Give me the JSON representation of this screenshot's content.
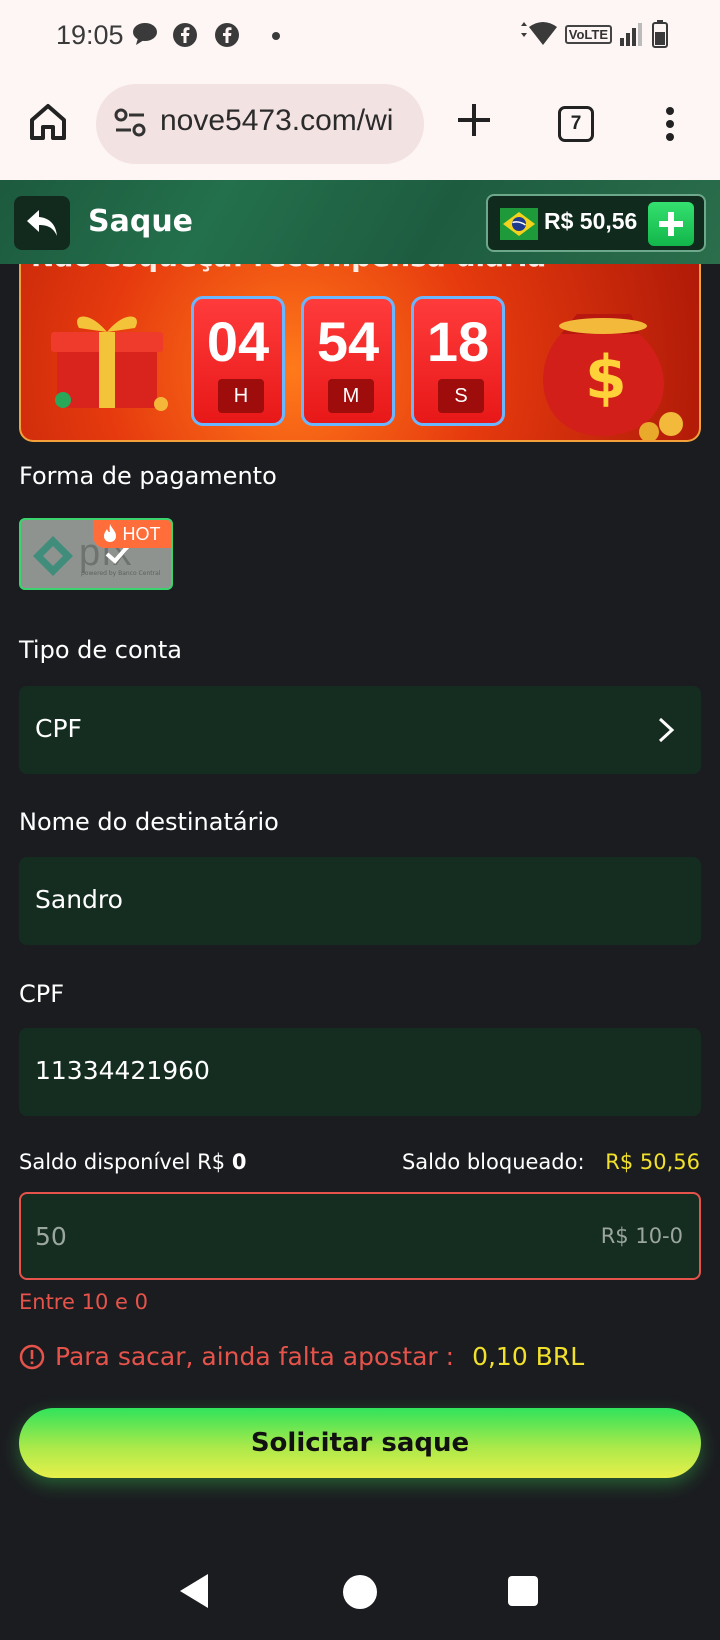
{
  "status_bar": {
    "time": "19:05",
    "volte": "VoLTE"
  },
  "browser": {
    "url": "nove5473.com/wi",
    "tab_count": "7"
  },
  "header": {
    "title": "Saque",
    "balance": "R$ 50,56"
  },
  "promo": {
    "text": "Não esqueça: recompensa diária",
    "timer": [
      {
        "value": "04",
        "unit": "H"
      },
      {
        "value": "54",
        "unit": "M"
      },
      {
        "value": "18",
        "unit": "S"
      }
    ]
  },
  "form": {
    "payment_label": "Forma de pagamento",
    "payment_method": {
      "name": "pix",
      "sub": "powered by Banco Central",
      "badge": "HOT"
    },
    "account_type_label": "Tipo de conta",
    "account_type_value": "CPF",
    "recipient_label": "Nome do destinatário",
    "recipient_value": "Sandro",
    "cpf_label": "CPF",
    "cpf_value": "11334421960",
    "saldo_disponivel_label": "Saldo disponível R$",
    "saldo_disponivel_value": "0",
    "saldo_bloqueado_label": "Saldo bloqueado:",
    "saldo_bloqueado_value": "R$ 50,56",
    "amount_placeholder": "50",
    "amount_range": "R$ 10-0",
    "error_text": "Entre 10 e 0",
    "warning_text": "Para sacar, ainda falta apostar :",
    "warning_amount": "0,10 BRL",
    "submit_label": "Solicitar saque"
  },
  "colors": {
    "accent_green": "#30e35b",
    "error_red": "#e5534b",
    "highlight_yellow": "#f2e12a",
    "field_bg": "#152d21"
  }
}
